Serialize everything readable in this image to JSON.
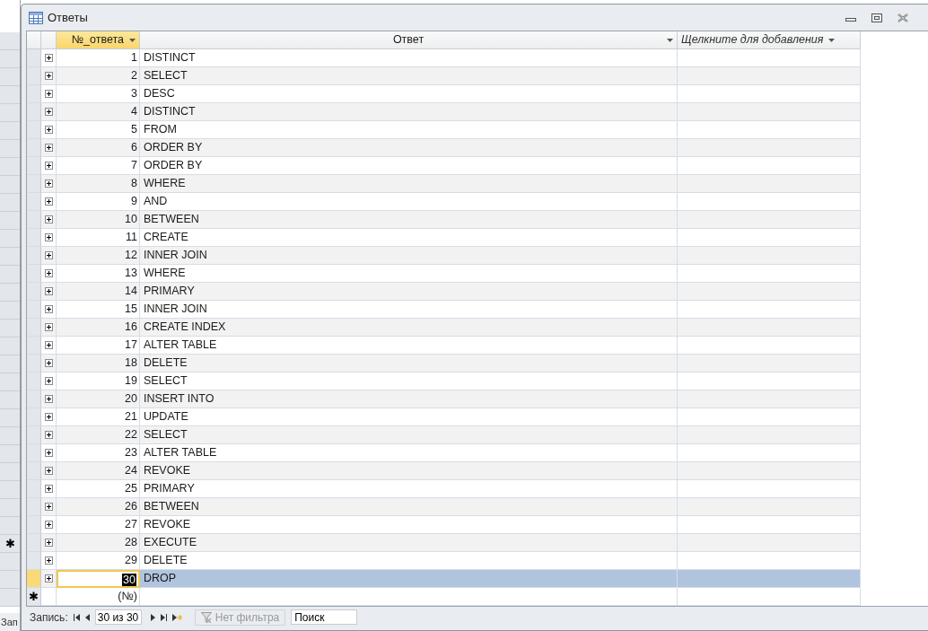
{
  "background": {
    "new_row_marker": "✱",
    "record_label": "Зап"
  },
  "window": {
    "title": "Ответы"
  },
  "columns": [
    {
      "label": "№_ответа",
      "selected": true,
      "kind": "number"
    },
    {
      "label": "Ответ",
      "selected": false,
      "kind": "text"
    },
    {
      "label": "Щелкните для добавления",
      "selected": false,
      "kind": "add"
    }
  ],
  "rows": [
    {
      "number": "1",
      "answer": "DISTINCT",
      "selected": false
    },
    {
      "number": "2",
      "answer": "SELECT",
      "selected": false
    },
    {
      "number": "3",
      "answer": "DESC",
      "selected": false
    },
    {
      "number": "4",
      "answer": "DISTINCT",
      "selected": false
    },
    {
      "number": "5",
      "answer": "FROM",
      "selected": false
    },
    {
      "number": "6",
      "answer": "ORDER BY",
      "selected": false
    },
    {
      "number": "7",
      "answer": "ORDER BY",
      "selected": false
    },
    {
      "number": "8",
      "answer": "WHERE",
      "selected": false
    },
    {
      "number": "9",
      "answer": "AND",
      "selected": false
    },
    {
      "number": "10",
      "answer": "BETWEEN",
      "selected": false
    },
    {
      "number": "11",
      "answer": "CREATE",
      "selected": false
    },
    {
      "number": "12",
      "answer": "INNER JOIN",
      "selected": false
    },
    {
      "number": "13",
      "answer": "WHERE",
      "selected": false
    },
    {
      "number": "14",
      "answer": "PRIMARY",
      "selected": false
    },
    {
      "number": "15",
      "answer": "INNER JOIN",
      "selected": false
    },
    {
      "number": "16",
      "answer": "CREATE INDEX",
      "selected": false
    },
    {
      "number": "17",
      "answer": "ALTER TABLE",
      "selected": false
    },
    {
      "number": "18",
      "answer": "DELETE",
      "selected": false
    },
    {
      "number": "19",
      "answer": "SELECT",
      "selected": false
    },
    {
      "number": "20",
      "answer": "INSERT INTO",
      "selected": false
    },
    {
      "number": "21",
      "answer": "UPDATE",
      "selected": false
    },
    {
      "number": "22",
      "answer": "SELECT",
      "selected": false
    },
    {
      "number": "23",
      "answer": "ALTER TABLE",
      "selected": false
    },
    {
      "number": "24",
      "answer": "REVOKE",
      "selected": false
    },
    {
      "number": "25",
      "answer": "PRIMARY",
      "selected": false
    },
    {
      "number": "26",
      "answer": "BETWEEN",
      "selected": false
    },
    {
      "number": "27",
      "answer": "REVOKE",
      "selected": false
    },
    {
      "number": "28",
      "answer": "EXECUTE",
      "selected": false
    },
    {
      "number": "29",
      "answer": "DELETE",
      "selected": false
    },
    {
      "number": "30",
      "answer": "DROP",
      "selected": true
    }
  ],
  "new_row": {
    "marker": "✱",
    "number": "(№)"
  },
  "navigation": {
    "label": "Запись:",
    "position": "30 из 30",
    "filter": "Нет фильтра",
    "search": {
      "placeholder": "Поиск"
    }
  }
}
